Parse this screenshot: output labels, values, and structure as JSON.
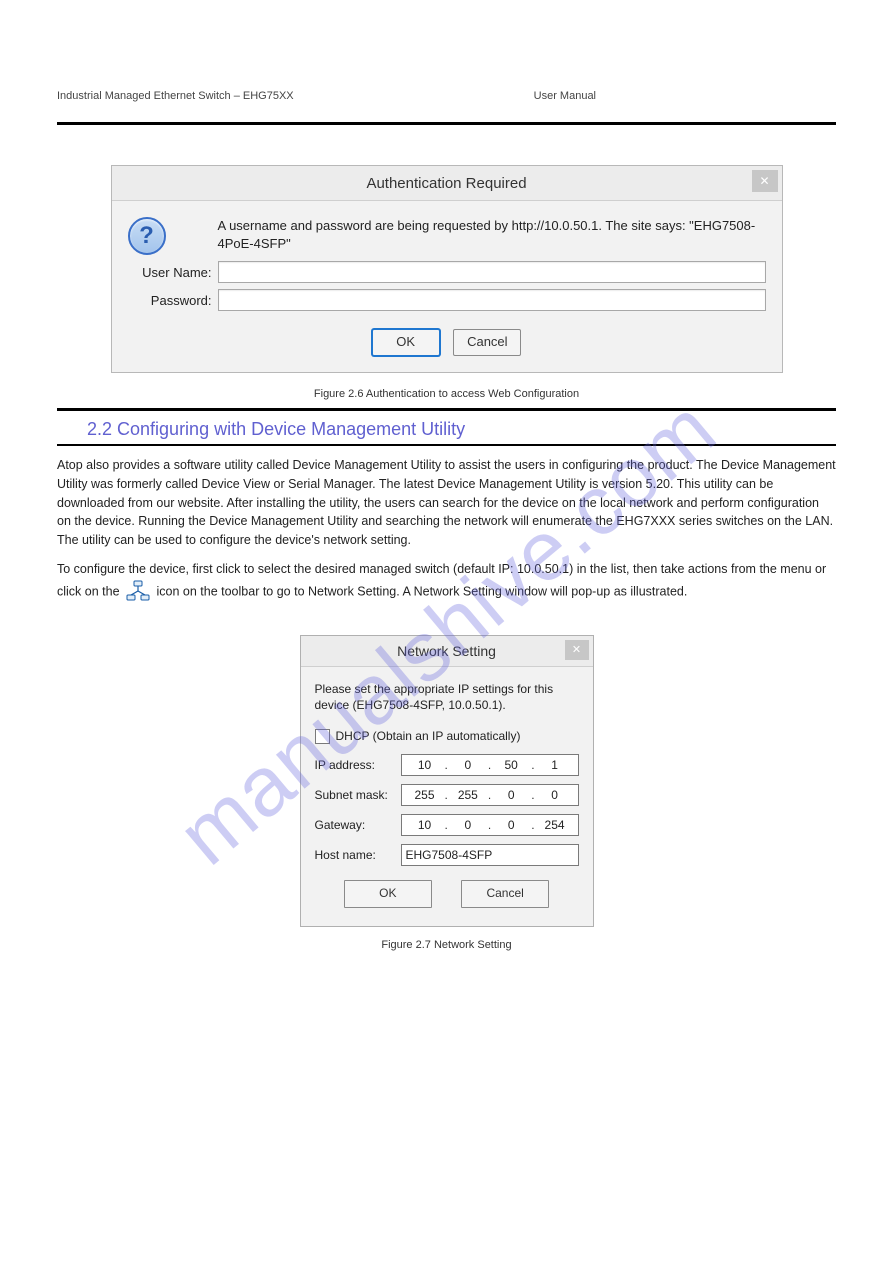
{
  "header_left": "Industrial Managed\nEthernet Switch – EHG75XX",
  "header_center": "User Manual",
  "header_right": "",
  "watermark_text": "manualshive.com",
  "auth_dialog": {
    "title": "Authentication Required",
    "message": "A username and password are being requested by http://10.0.50.1. The site says: \"EHG7508-4PoE-4SFP\"",
    "username_label": "User Name:",
    "password_label": "Password:",
    "ok_label": "OK",
    "cancel_label": "Cancel",
    "close_glyph": "✕"
  },
  "caption1": "Figure 2.6 Authentication to access Web Configuration",
  "section_heading": "2.2 Configuring with Device Management Utility",
  "para1": "Atop also provides a software utility called Device Management Utility to assist the users in configuring the product. The Device Management Utility was formerly called Device View or Serial Manager. The latest Device Management Utility is version 5.20. This utility can be downloaded from our website. After installing the utility, the users can search for the device on the local network and perform configuration on the device. Running the Device Management Utility and searching the network will enumerate the EHG7XXX series switches on the LAN. The utility can be used to configure the device's network setting.",
  "para2_before": "To configure the device, first click to select the desired managed switch (default IP: 10.0.50.1) in the list, then take actions from the menu or click on the ",
  "para2_after": " icon on the toolbar to go to Network Setting. A Network Setting window will pop-up as illustrated.",
  "net_dialog": {
    "title": "Network Setting",
    "message": "Please set the appropriate IP settings for this device (EHG7508-4SFP, 10.0.50.1).",
    "dhcp_label": "DHCP (Obtain an IP automatically)",
    "ip_label": "IP address:",
    "mask_label": "Subnet mask:",
    "gw_label": "Gateway:",
    "host_label": "Host name:",
    "ip": [
      "10",
      "0",
      "50",
      "1"
    ],
    "mask": [
      "255",
      "255",
      "0",
      "0"
    ],
    "gw": [
      "10",
      "0",
      "0",
      "254"
    ],
    "hostname": "EHG7508-4SFP",
    "ok_label": "OK",
    "cancel_label": "Cancel",
    "close_glyph": "✕"
  },
  "caption2": "Figure 2.7 Network Setting"
}
